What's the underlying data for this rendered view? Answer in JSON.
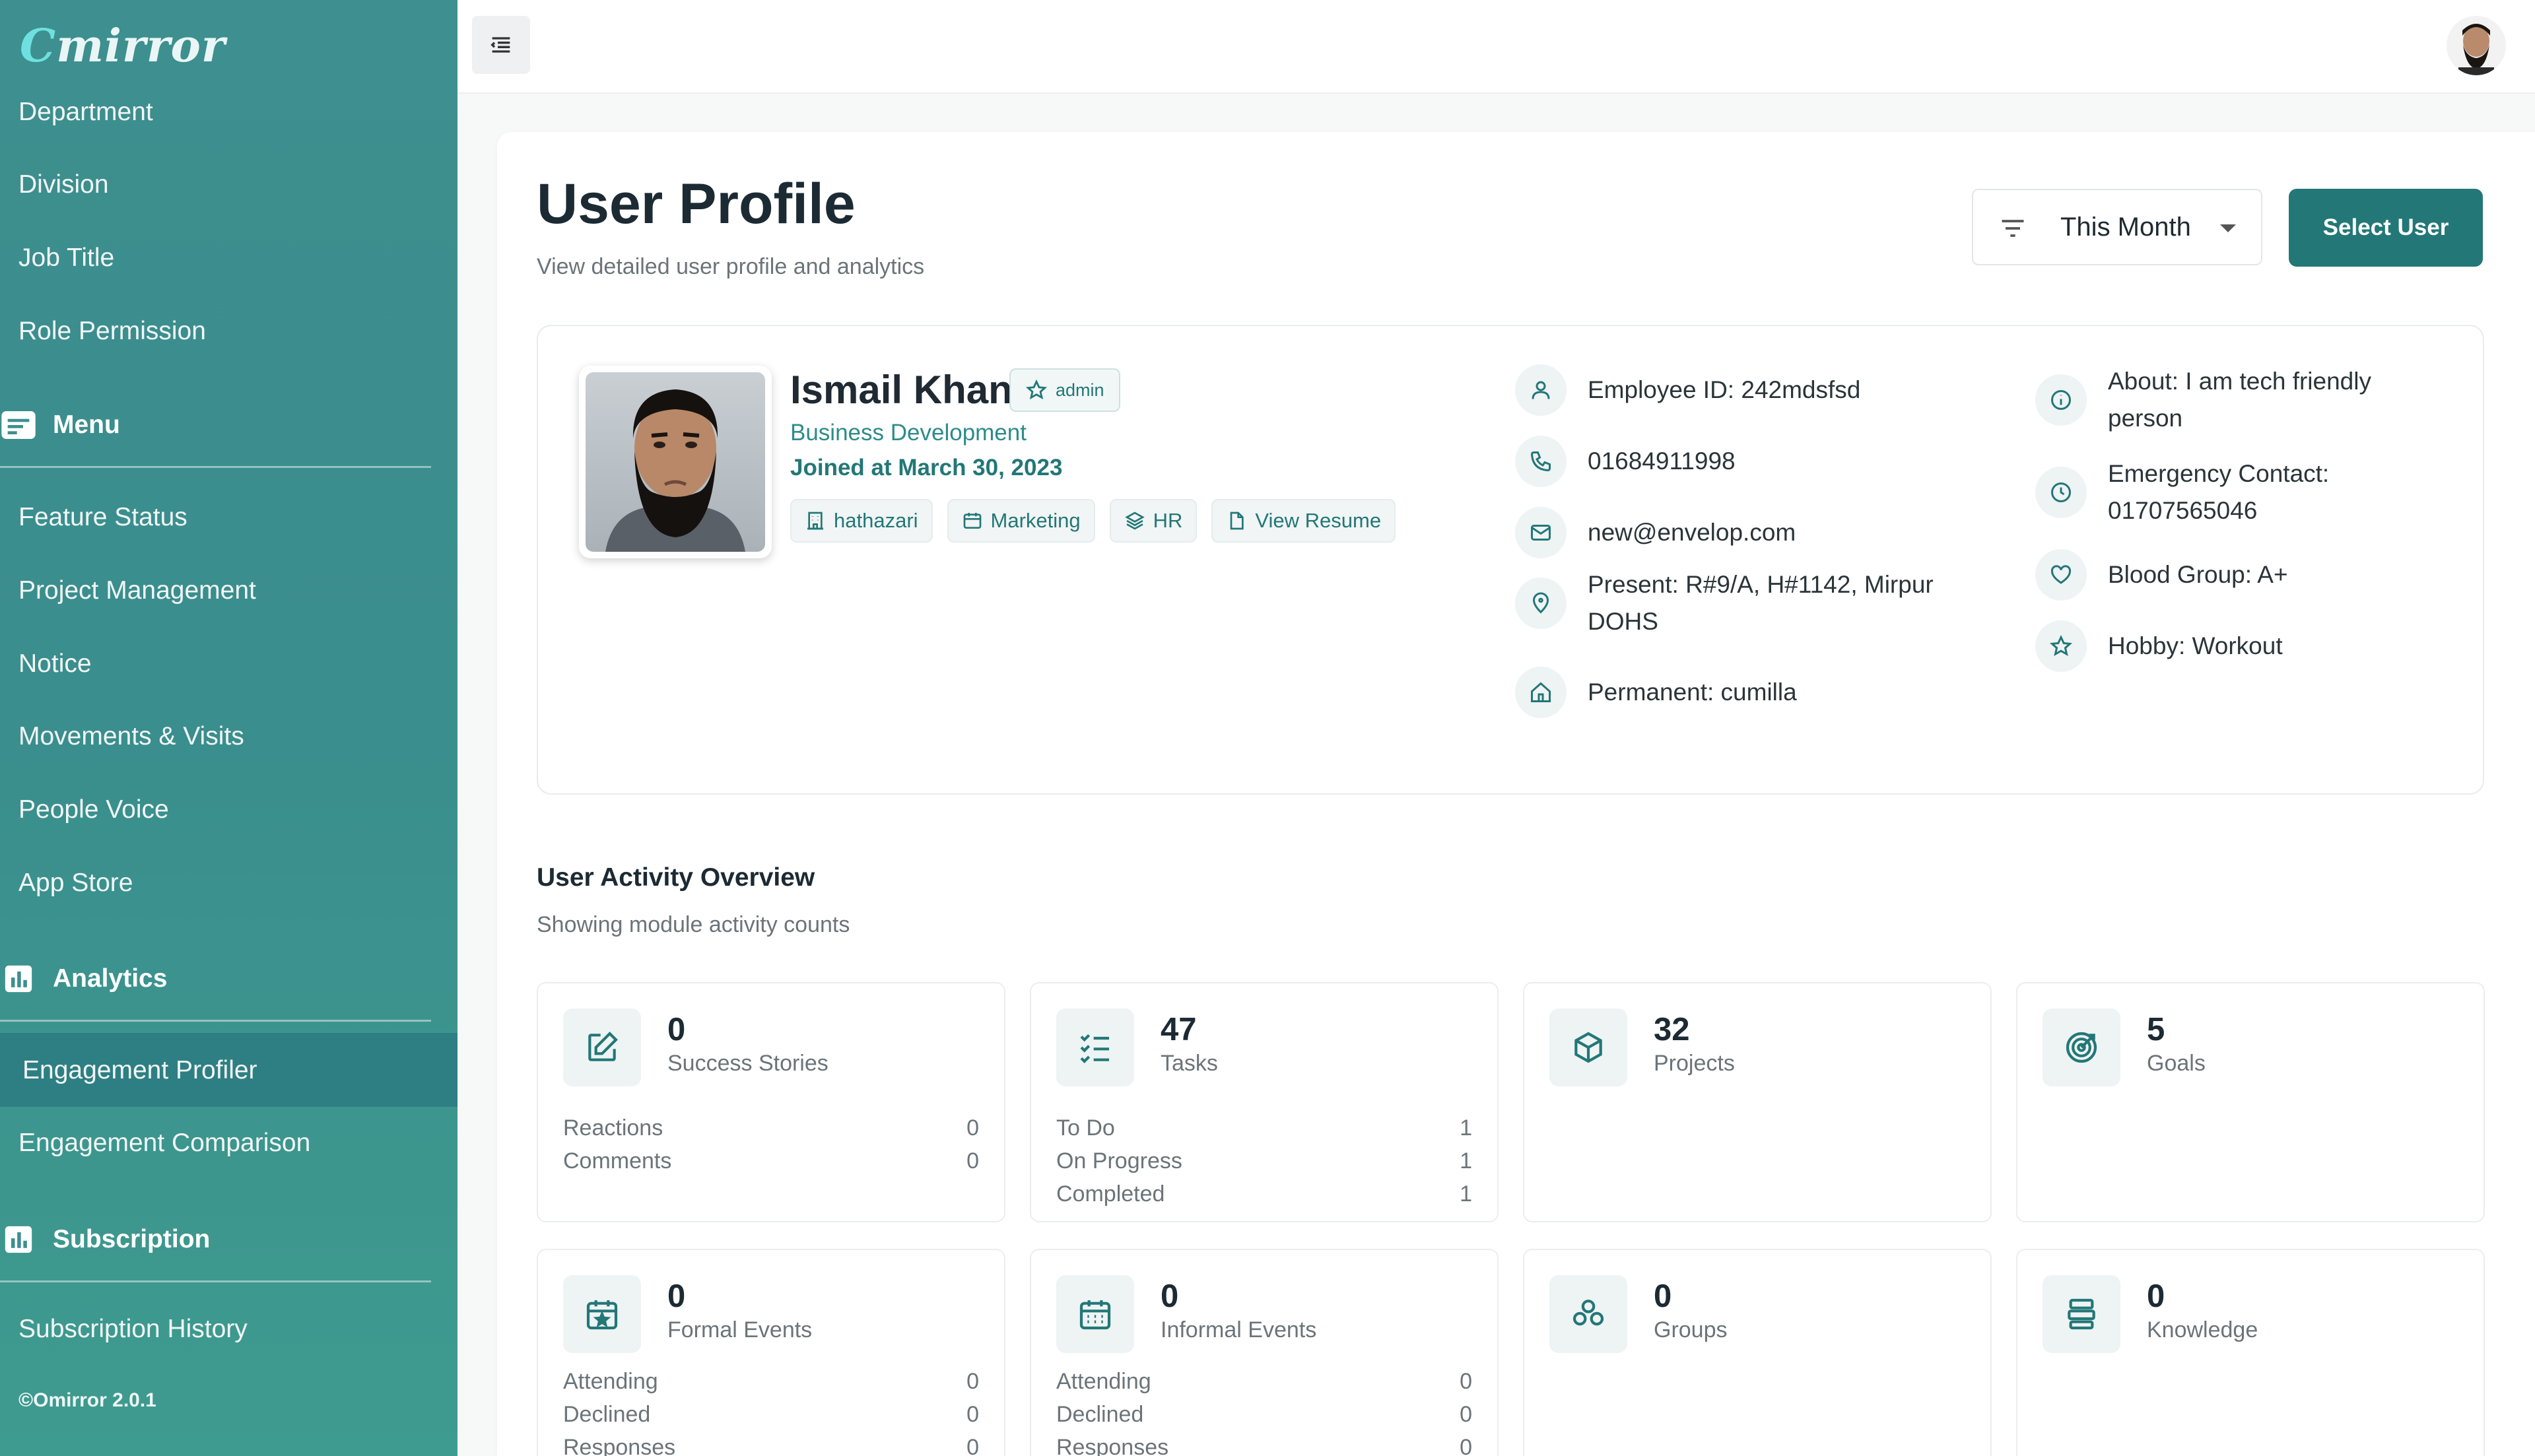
{
  "app": {
    "logo_text": "mirror",
    "version": "©Omirror 2.0.1"
  },
  "sidebar": {
    "top_items": [
      "Department",
      "Division",
      "Job Title",
      "Role Permission"
    ],
    "sections": {
      "menu": "Menu",
      "analytics": "Analytics",
      "subscription": "Subscription"
    },
    "menu_items": [
      "Feature Status",
      "Project Management",
      "Notice",
      "Movements & Visits",
      "People Voice",
      "App Store"
    ],
    "analytics_items": [
      "Engagement Profiler",
      "Engagement Comparison"
    ],
    "subscription_items": [
      "Subscription History"
    ],
    "active_item": "Engagement Profiler"
  },
  "page": {
    "title": "User Profile",
    "subtitle": "View detailed user profile and analytics",
    "filter_value": "This Month",
    "select_user_label": "Select User"
  },
  "profile": {
    "name": "Ismail Khan",
    "role_badge": "admin",
    "department": "Business Development",
    "joined": "Joined at March 30, 2023",
    "chips": [
      "hathazari",
      "Marketing",
      "HR",
      "View Resume"
    ],
    "employee_id": "Employee ID: 242mdsfsd",
    "phone": "01684911998",
    "email": "new@envelop.com",
    "present_address_line1": "Present: R#9/A, H#1142, Mirpur",
    "present_address_line2": "DOHS",
    "permanent_address": "Permanent: cumilla",
    "about_line1": "About: I am tech friendly",
    "about_line2": "person",
    "emergency_line1": "Emergency Contact:",
    "emergency_line2": "01707565046",
    "blood_group": "Blood Group: A+",
    "hobby": "Hobby: Workout"
  },
  "activity": {
    "title": "User Activity Overview",
    "subtitle": "Showing module activity counts",
    "tiles": [
      {
        "icon": "edit-icon",
        "count": "0",
        "label": "Success Stories",
        "rows": [
          [
            "Reactions",
            "0"
          ],
          [
            "Comments",
            "0"
          ]
        ]
      },
      {
        "icon": "checklist-icon",
        "count": "47",
        "label": "Tasks",
        "rows": [
          [
            "To Do",
            "1"
          ],
          [
            "On Progress",
            "1"
          ],
          [
            "Completed",
            "1"
          ]
        ]
      },
      {
        "icon": "cube-icon",
        "count": "32",
        "label": "Projects",
        "rows": []
      },
      {
        "icon": "target-icon",
        "count": "5",
        "label": "Goals",
        "rows": []
      },
      {
        "icon": "calendar-star-icon",
        "count": "0",
        "label": "Formal Events",
        "rows": [
          [
            "Attending",
            "0"
          ],
          [
            "Declined",
            "0"
          ],
          [
            "Responses",
            "0"
          ]
        ]
      },
      {
        "icon": "calendar-grid-icon",
        "count": "0",
        "label": "Informal Events",
        "rows": [
          [
            "Attending",
            "0"
          ],
          [
            "Declined",
            "0"
          ],
          [
            "Responses",
            "0"
          ]
        ]
      },
      {
        "icon": "group-icon",
        "count": "0",
        "label": "Groups",
        "rows": []
      },
      {
        "icon": "books-icon",
        "count": "0",
        "label": "Knowledge",
        "rows": []
      }
    ]
  },
  "colors": {
    "primary": "#237777",
    "sidebar": "#3e8f8f",
    "sidebar_active": "#2e7f83",
    "accent_text": "#2d8c8a"
  }
}
